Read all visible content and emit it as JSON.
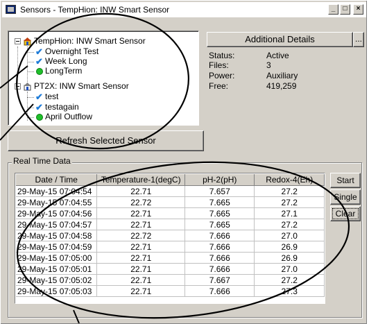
{
  "window": {
    "title": "Sensors - TempHion: INW Smart Sensor",
    "min_label": "_",
    "max_label": "□",
    "close_label": "×"
  },
  "tree": [
    {
      "kind": "sensor",
      "label": "TempHion: INW Smart Sensor",
      "icon": "sensor-icon"
    },
    {
      "kind": "child",
      "label": "Overnight Test",
      "icon": "check-icon"
    },
    {
      "kind": "child",
      "label": "Week Long",
      "icon": "check-icon"
    },
    {
      "kind": "child",
      "label": "LongTerm",
      "icon": "green-dot-icon"
    },
    {
      "kind": "sensor",
      "label": "PT2X: INW Smart Sensor",
      "icon": "sensor-icon"
    },
    {
      "kind": "child",
      "label": "test",
      "icon": "check-icon"
    },
    {
      "kind": "child",
      "label": "testagain",
      "icon": "check-icon"
    },
    {
      "kind": "child",
      "label": "April Outflow",
      "icon": "green-dot-icon"
    }
  ],
  "refresh_button": "Refresh Selected Sensor",
  "details": {
    "button": "Additional Details",
    "more_button": "...",
    "status_label": "Status:",
    "status_value": "Active",
    "files_label": "Files:",
    "files_value": "3",
    "power_label": "Power:",
    "power_value": "Auxiliary",
    "free_label": "Free:",
    "free_value": "419,259"
  },
  "realtime": {
    "group_title": "Real Time Data",
    "columns": [
      "Date / Time",
      "Temperature-1(degC)",
      "pH-2(pH)",
      "Redox-4(Eh)"
    ],
    "rows": [
      [
        "29-May-15 07:04:54",
        "22.71",
        "7.657",
        "27.2"
      ],
      [
        "29-May-15 07:04:55",
        "22.72",
        "7.665",
        "27.2"
      ],
      [
        "29-May-15 07:04:56",
        "22.71",
        "7.665",
        "27.1"
      ],
      [
        "29-May-15 07:04:57",
        "22.71",
        "7.665",
        "27.2"
      ],
      [
        "29-May-15 07:04:58",
        "22.72",
        "7.666",
        "27.0"
      ],
      [
        "29-May-15 07:04:59",
        "22.71",
        "7.666",
        "26.9"
      ],
      [
        "29-May-15 07:05:00",
        "22.71",
        "7.666",
        "26.9"
      ],
      [
        "29-May-15 07:05:01",
        "22.71",
        "7.666",
        "27.0"
      ],
      [
        "29-May-15 07:05:02",
        "22.71",
        "7.667",
        "27.2"
      ],
      [
        "29-May-15 07:05:03",
        "22.71",
        "7.666",
        "27.3"
      ]
    ],
    "start_button": "Start",
    "single_button": "Single",
    "clear_button": "Clear"
  },
  "colors": {
    "window_bg": "#d4d0c8",
    "check": "#1f7cd8",
    "green_dot": "#1fbf2a",
    "annotation": "#000000"
  }
}
